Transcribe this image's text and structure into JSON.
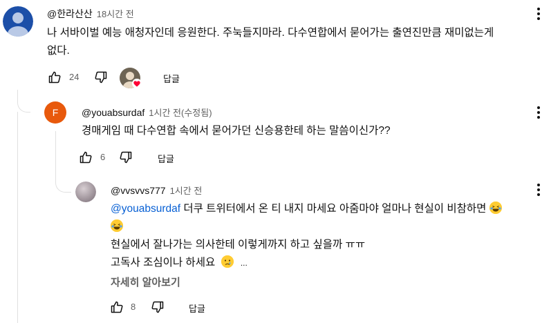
{
  "comments": [
    {
      "handle": "@한라산산",
      "time": "18시간 전",
      "text_line1": "나 서바이벌 예능 애청자인데 응원한다. 주눅들지마라. 다수연합에서 묻어가는 출연진만큼 재미없는게",
      "text_line2": "없다.",
      "likes": "24",
      "reply_label": "답글",
      "avatar_color": "#1c4fa8"
    },
    {
      "handle": "@youabsurdaf",
      "time": "1시간 전(수정됨)",
      "avatar_letter": "F",
      "avatar_color": "#e8590c",
      "text": "경매게임 때 다수연합 속에서 묻어가던 신승용한테 하는 말씀이신가??",
      "likes": "6",
      "reply_label": "답글"
    },
    {
      "handle": "@vvsvvs777",
      "time": "1시간 전",
      "mention": "@youabsurdaf",
      "text_line1": " 더쿠 트위터에서 온 티 내지 마세요 아줌마야 얼마나 현실이 비참하면",
      "text_line3": "현실에서 잘나가는 의사한테 이렇게까지 하고 싶을까 ㅠㅠ",
      "text_line4": "고독사 조심이나 하세요",
      "ellipsis": "...",
      "read_more": "자세히 알아보기",
      "likes": "8",
      "reply_label": "답글"
    }
  ],
  "icons": {
    "like": "thumb-up-icon",
    "dislike": "thumb-down-icon",
    "more": "more-vert-icon",
    "heart": "creator-heart-icon",
    "laugh": "laughing-emoji",
    "cry": "crying-emoji"
  }
}
